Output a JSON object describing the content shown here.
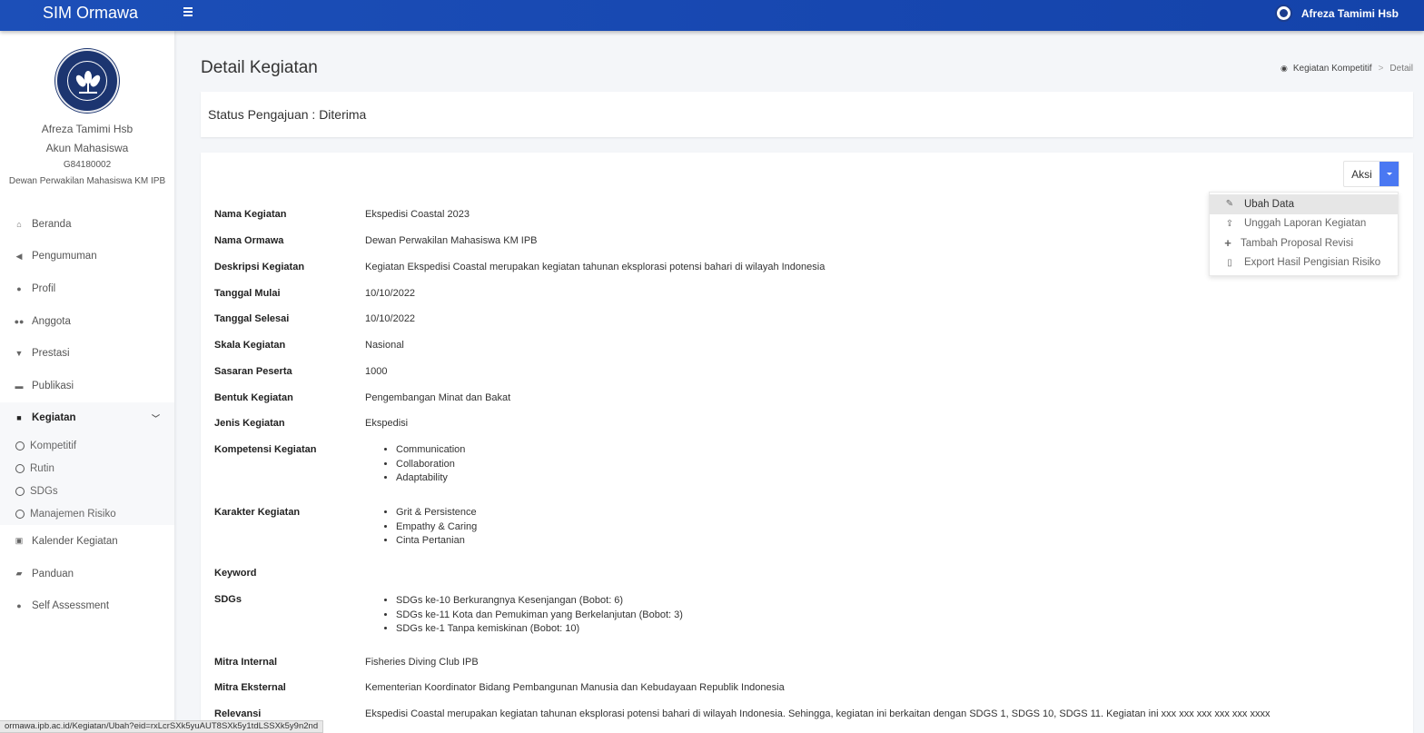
{
  "app": {
    "brand": "SIM Ormawa",
    "top_user": "Afreza Tamimi Hsb"
  },
  "profile": {
    "name": "Afreza Tamimi Hsb",
    "role": "Akun Mahasiswa",
    "nim": "G84180002",
    "org": "Dewan Perwakilan Mahasiswa KM IPB"
  },
  "nav": {
    "items": [
      {
        "label": "Beranda",
        "icon": "home-icon"
      },
      {
        "label": "Pengumuman",
        "icon": "megaphone-icon"
      },
      {
        "label": "Profil",
        "icon": "user-icon"
      },
      {
        "label": "Anggota",
        "icon": "users-icon"
      },
      {
        "label": "Prestasi",
        "icon": "trophy-icon"
      },
      {
        "label": "Publikasi",
        "icon": "comments-icon"
      },
      {
        "label": "Kegiatan",
        "icon": "folder-icon"
      }
    ],
    "sub_items": [
      "Kompetitif",
      "Rutin",
      "SDGs",
      "Manajemen Risiko"
    ],
    "after_items": [
      {
        "label": "Kalender Kegiatan",
        "icon": "calendar-icon"
      },
      {
        "label": "Panduan",
        "icon": "book-icon"
      },
      {
        "label": "Self Assessment",
        "icon": "user-icon"
      }
    ]
  },
  "page": {
    "title": "Detail Kegiatan",
    "breadcrumb": {
      "parent": "Kegiatan Kompetitif",
      "separator": ">",
      "current": "Detail"
    },
    "status": "Status Pengajuan : Diterima"
  },
  "actions": {
    "button_label": "Aksi",
    "menu": [
      {
        "label": "Ubah Data",
        "icon": "edit-icon"
      },
      {
        "label": "Unggah Laporan Kegiatan",
        "icon": "upload-icon"
      },
      {
        "label": "Tambah Proposal Revisi",
        "icon": "plus-icon"
      },
      {
        "label": "Export Hasil Pengisian Risiko",
        "icon": "pdf-file-icon"
      }
    ]
  },
  "details": {
    "nama_kegiatan": {
      "label": "Nama Kegiatan",
      "value": "Ekspedisi Coastal 2023"
    },
    "nama_ormawa": {
      "label": "Nama Ormawa",
      "value": "Dewan Perwakilan Mahasiswa KM IPB"
    },
    "deskripsi": {
      "label": "Deskripsi Kegiatan",
      "value": "Kegiatan Ekspedisi Coastal merupakan kegiatan tahunan eksplorasi potensi bahari di wilayah Indonesia"
    },
    "tanggal_mulai": {
      "label": "Tanggal Mulai",
      "value": "10/10/2022"
    },
    "tanggal_selesai": {
      "label": "Tanggal Selesai",
      "value": "10/10/2022"
    },
    "skala": {
      "label": "Skala Kegiatan",
      "value": "Nasional"
    },
    "sasaran": {
      "label": "Sasaran Peserta",
      "value": "1000"
    },
    "bentuk": {
      "label": "Bentuk Kegiatan",
      "value": "Pengembangan Minat dan Bakat"
    },
    "jenis": {
      "label": "Jenis Kegiatan",
      "value": "Ekspedisi"
    },
    "kompetensi": {
      "label": "Kompetensi Kegiatan",
      "values": [
        "Communication",
        "Collaboration",
        "Adaptability"
      ]
    },
    "karakter": {
      "label": "Karakter Kegiatan",
      "values": [
        "Grit & Persistence",
        "Empathy & Caring",
        "Cinta Pertanian"
      ]
    },
    "keyword": {
      "label": "Keyword",
      "value": ""
    },
    "sdgs": {
      "label": "SDGs",
      "values": [
        "SDGs ke-10 Berkurangnya Kesenjangan (Bobot: 6)",
        "SDGs ke-11 Kota dan Pemukiman yang Berkelanjutan (Bobot: 3)",
        "SDGs ke-1 Tanpa kemiskinan (Bobot: 10)"
      ]
    },
    "mitra_internal": {
      "label": "Mitra Internal",
      "value": "Fisheries Diving Club IPB"
    },
    "mitra_eksternal": {
      "label": "Mitra Eksternal",
      "value": "Kementerian Koordinator Bidang Pembangunan Manusia dan Kebudayaan Republik Indonesia"
    },
    "relevansi": {
      "label": "Relevansi",
      "value": "Ekspedisi Coastal merupakan kegiatan tahunan eksplorasi potensi bahari di wilayah Indonesia. Sehingga, kegiatan ini berkaitan dengan SDGS 1, SDGS 10, SDGS 11. Kegiatan ini xxx xxx xxx xxx xxx xxxx"
    }
  },
  "status_bar": {
    "url": "ormawa.ipb.ac.id/Kegiatan/Ubah?eid=rxLcrSXk5yuAUT8SXk5y1tdLSSXk5y9n2nd"
  },
  "colors": {
    "topbar": "#1c4fb8",
    "accent": "#4a78f2"
  }
}
